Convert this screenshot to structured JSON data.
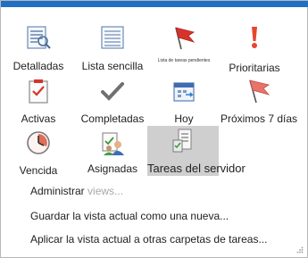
{
  "views": [
    {
      "label": "Detalladas",
      "icon": "detailed-list-icon"
    },
    {
      "label": "Lista sencilla",
      "icon": "simple-list-icon"
    },
    {
      "label": "Lista de tareas pendientes",
      "icon": "flag-icon"
    },
    {
      "label": "Prioritarias",
      "icon": "exclamation-icon"
    },
    {
      "label": "Activas",
      "icon": "active-tasks-icon"
    },
    {
      "label": "Completadas",
      "icon": "checkmark-icon"
    },
    {
      "label": "Hoy",
      "icon": "calendar-today-icon"
    },
    {
      "label": "Próximos 7 días",
      "icon": "next-seven-days-icon"
    },
    {
      "label": "Vencida",
      "icon": "clock-icon"
    },
    {
      "label": "Asignadas",
      "icon": "assigned-tasks-icon"
    },
    {
      "label": "Tareas del servidor",
      "icon": "server-tasks-icon"
    }
  ],
  "selected_view": "Tareas del servidor",
  "menu": {
    "manage_prefix": "Administrar",
    "manage_faded": " views...",
    "save_view": "Guardar la vista actual como una nueva...",
    "apply_view": "Aplicar la vista actual a otras carpetas de tareas..."
  },
  "colors": {
    "accent": "#1f6fc4",
    "selected_bg": "#cfcfcf",
    "flag_red": "#d8332b"
  }
}
